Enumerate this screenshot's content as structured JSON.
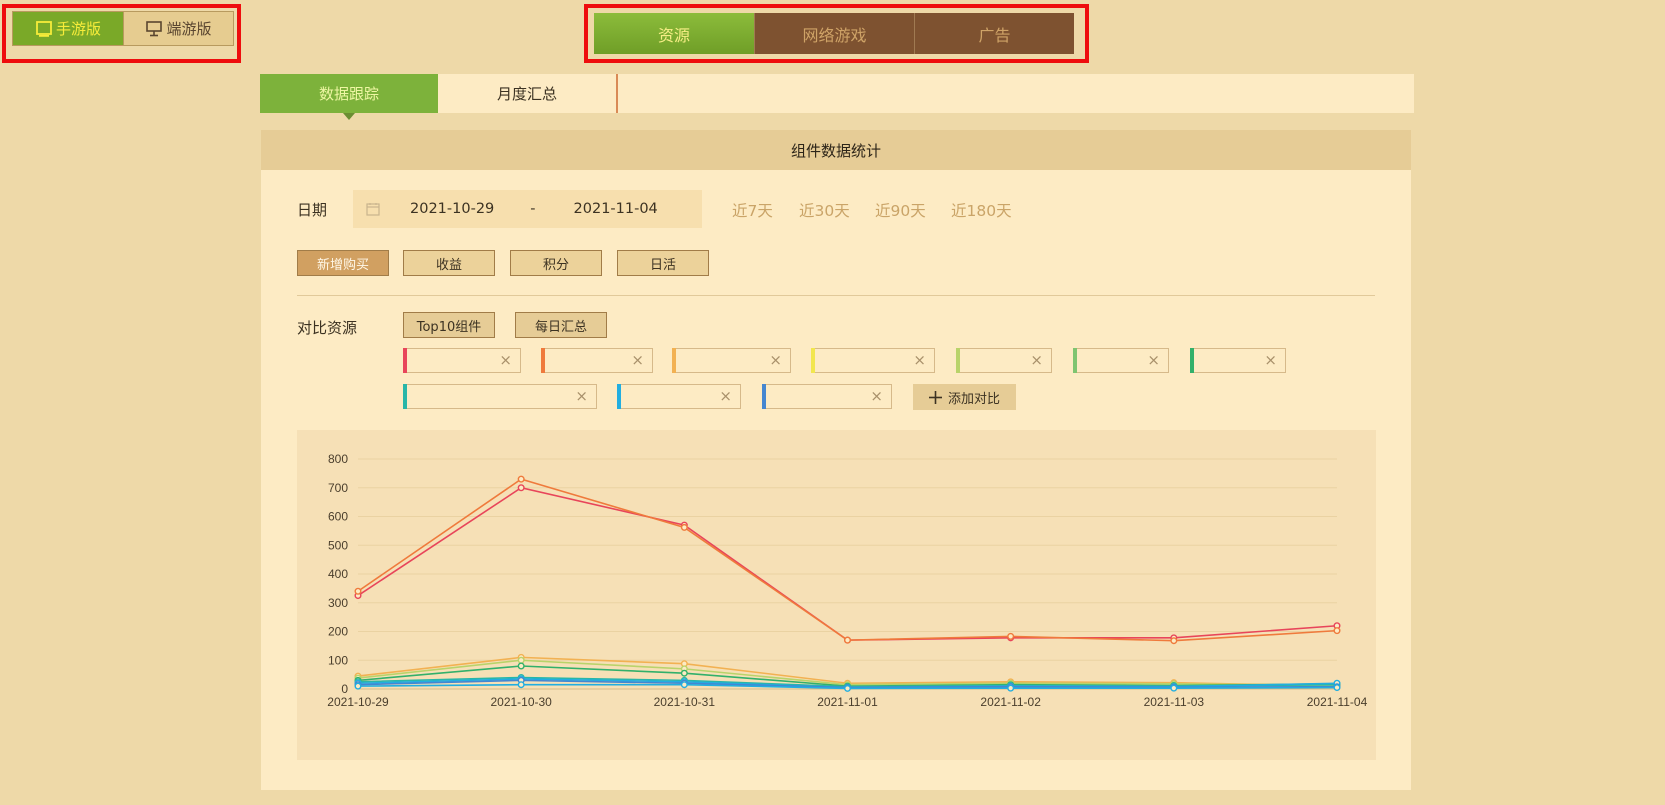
{
  "platform": {
    "mobile_label": "手游版",
    "pc_label": "端游版"
  },
  "categories": {
    "tabs": [
      "资源",
      "网络游戏",
      "广告"
    ],
    "active": "资源"
  },
  "subtabs": {
    "tracking_label": "数据跟踪",
    "monthly_label": "月度汇总"
  },
  "panel": {
    "title": "组件数据统计",
    "date_label": "日期",
    "start_date": "2021-10-29",
    "date_sep": "-",
    "end_date": "2021-11-04",
    "quick_ranges": [
      "近7天",
      "近30天",
      "近90天",
      "近180天"
    ],
    "metrics": [
      "新增购买",
      "收益",
      "积分",
      "日活"
    ],
    "active_metric": "新增购买",
    "compare_label": "对比资源",
    "top10_label": "Top10组件",
    "daily_label": "每日汇总",
    "add_compare_label": "添加对比",
    "close_symbol": "×",
    "slot_colors": [
      "#e8455a",
      "#ef7a3c",
      "#f2b152",
      "#f2e64e",
      "#b9d36a",
      "#7fc470",
      "#32b06a",
      "#29b6a8",
      "#22aee0",
      "#4586d0"
    ]
  },
  "chart_data": {
    "type": "line",
    "x": [
      "2021-10-29",
      "2021-10-30",
      "2021-10-31",
      "2021-11-01",
      "2021-11-02",
      "2021-11-03",
      "2021-11-04"
    ],
    "ylim": [
      0,
      800
    ],
    "yticks": [
      0,
      100,
      200,
      300,
      400,
      500,
      600,
      700,
      800
    ],
    "grid": true,
    "series": [
      {
        "color": "#e8455a",
        "values": [
          325,
          700,
          570,
          170,
          178,
          178,
          220
        ]
      },
      {
        "color": "#ef7a3c",
        "values": [
          340,
          730,
          562,
          170,
          183,
          168,
          203
        ]
      },
      {
        "color": "#f2b152",
        "values": [
          45,
          110,
          88,
          20,
          25,
          22,
          10
        ]
      },
      {
        "color": "#b9d36a",
        "values": [
          38,
          100,
          70,
          15,
          20,
          18,
          12
        ]
      },
      {
        "color": "#32b06a",
        "values": [
          30,
          80,
          55,
          10,
          15,
          12,
          18
        ]
      },
      {
        "color": "#29b6a8",
        "values": [
          25,
          40,
          30,
          8,
          12,
          10,
          15
        ]
      },
      {
        "color": "#22aee0",
        "values": [
          20,
          35,
          25,
          5,
          10,
          8,
          20
        ]
      },
      {
        "color": "#4586d0",
        "values": [
          15,
          30,
          20,
          5,
          8,
          6,
          8
        ]
      },
      {
        "color": "#22aee0",
        "values": [
          10,
          15,
          15,
          2,
          3,
          3,
          5
        ]
      }
    ]
  }
}
